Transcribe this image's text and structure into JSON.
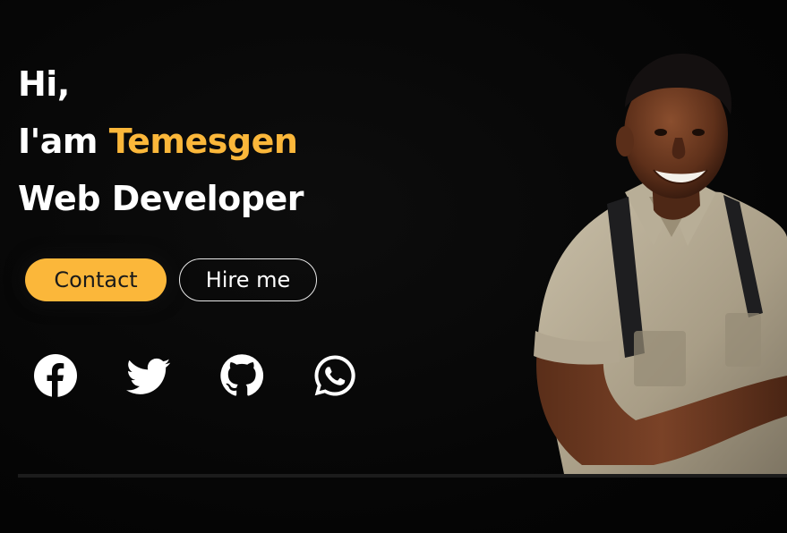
{
  "hero": {
    "greeting": "Hi,",
    "intro_prefix": "I'am ",
    "name": "Temesgen",
    "role": "Web Developer"
  },
  "actions": {
    "contact_label": "Contact",
    "hire_label": "Hire me"
  },
  "socials": [
    {
      "icon": "facebook-icon"
    },
    {
      "icon": "twitter-icon"
    },
    {
      "icon": "github-icon"
    },
    {
      "icon": "whatsapp-icon"
    }
  ],
  "colors": {
    "accent": "#fbb73a",
    "background": "#060606",
    "text": "#ffffff"
  }
}
